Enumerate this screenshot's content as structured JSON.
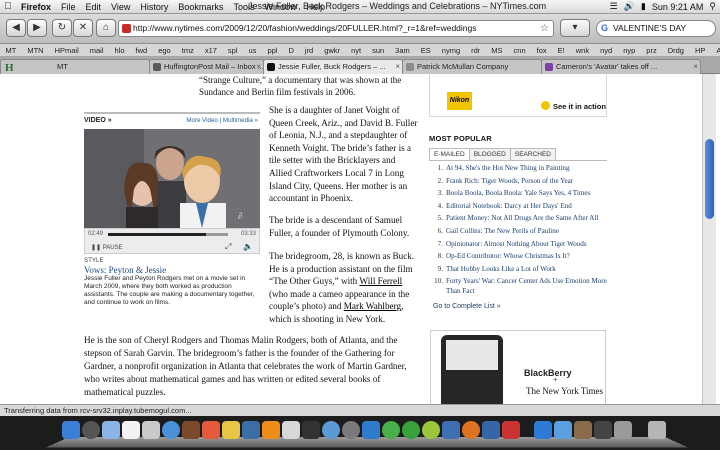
{
  "menubar": {
    "app": "Firefox",
    "items": [
      "File",
      "Edit",
      "View",
      "History",
      "Bookmarks",
      "Tools",
      "Window",
      "Help"
    ],
    "window_title": "Jessie Fuller, Buck Rodgers – Weddings and Celebrations – NYTimes.com",
    "clock": "Sun 9:21 AM"
  },
  "toolbar": {
    "url": "http://www.nytimes.com/2009/12/20/fashion/weddings/20FULLER.html?_r=1&ref=weddings",
    "search_value": "VALENTINE'S DAY"
  },
  "bookmarks": [
    "MT",
    "MTN",
    "HPmail",
    "mail",
    "hlo",
    "fwd",
    "ego",
    "tmz",
    "x17",
    "spl",
    "us",
    "ppl",
    "D",
    "jrd",
    "gwkr",
    "nyt",
    "sun",
    "3am",
    "ES",
    "nymg",
    "rdr",
    "MS",
    "cnn",
    "fox",
    "E!",
    "wnk",
    "nyd",
    "nyp",
    "prz",
    "Drdg",
    "HP",
    "ADM"
  ],
  "tabs": [
    {
      "label": "MT"
    },
    {
      "label": "HuffingtonPost Mail – Inbox ..."
    },
    {
      "label": "Jessie Fuller, Buck Rodgers – ..."
    },
    {
      "label": "Patrick McMullan Company"
    },
    {
      "label": "Cameron's 'Avatar' takes off ..."
    }
  ],
  "article": {
    "top_lines": [
      "“Strange Culture,” a documentary that was shown at the",
      "Sundance and Berlin film festivals in 2006."
    ],
    "para1": "She is a daughter of Janet Voight of Queen Creek, Ariz., and David B. Fuller of Leonia, N.J., and a stepdaughter of Kenneth Voight. The bride’s father is a tile setter with the Bricklayers and Allied Craftworkers Local 7 in Long Island City, Queens. Her mother is an accountant in Phoenix.",
    "para2": "The bride is a descendant of Samuel Fuller, a founder of Plymouth Colony.",
    "para3_start": "The bridegroom, 28, is known as Buck. He is a production assistant on the film “The Other Guys,” with ",
    "para3_link1": "Will Ferrell",
    "para3_mid": " (who made a cameo appearance in the couple’s photo) and ",
    "para3_link2": "Mark Wahlberg",
    "para3_end": ", which is shooting in New York.",
    "para4": "He is the son of Cheryl Rodgers and Thomas Malin Rodgers, both of Atlanta, and the stepson of Sarah Garvin. The bridegroom’s father is the founder of the Gathering for Gardner, a nonprofit organization in Atlanta that celebrates the work of Martin Gardner, who writes about mathematical games and has written or edited several books of mathematical puzzles."
  },
  "video": {
    "header": "VIDEO »",
    "links": "More Video | Multimedia »",
    "time_elapsed": "02:49",
    "time_total": "03:33",
    "progress": 0.82,
    "pause_label": "PAUSE",
    "style_label": "STYLE",
    "title": "Vows: Peyton & Jessie",
    "caption": "Jessie Fuller and Peyton Rodgers met on a movie set in March 2009, where they both worked as production assistants. The couple are making a documentary together, and continue to work on films."
  },
  "ads": {
    "nikon_logo": "Nikon",
    "see_action": "See it in action",
    "blackberry": "BlackBerry",
    "plus": "+",
    "nyt_logo": "The New York Times"
  },
  "most_popular": {
    "title": "MOST POPULAR",
    "tabs": [
      "E-MAILED",
      "BLOGGED",
      "SEARCHED"
    ],
    "items": [
      {
        "n": "1.",
        "text": "At 94, She's the Hot New Thing in Painting"
      },
      {
        "n": "2.",
        "text": "Frank Rich: Tiger Woods, Person of the Year"
      },
      {
        "n": "3.",
        "text": "Boola Boola, Boola Boola: Yale Says Yes, 4 Times"
      },
      {
        "n": "4.",
        "text": "Editorial Notebook: Darcy at Her Days' End"
      },
      {
        "n": "5.",
        "text": "Patient Money: Not All Drugs Are the Same After All"
      },
      {
        "n": "6.",
        "text": "Gail Collins: The New Perils of Pauline"
      },
      {
        "n": "7.",
        "text": "Opinionator: Almost Nothing About Tiger Woods"
      },
      {
        "n": "8.",
        "text": "Op-Ed Contributor: Whose Christmas Is It?"
      },
      {
        "n": "9.",
        "text": "That Hobby Looks Like a Lot of Work"
      },
      {
        "n": "10.",
        "text": "Forty Years' War: Cancer Center Ads Use Emotion More Than Fact"
      }
    ],
    "link": "Go to Complete List »"
  },
  "status": "Transferring data from rcv-srv32.inplay.tubemogul.com..."
}
